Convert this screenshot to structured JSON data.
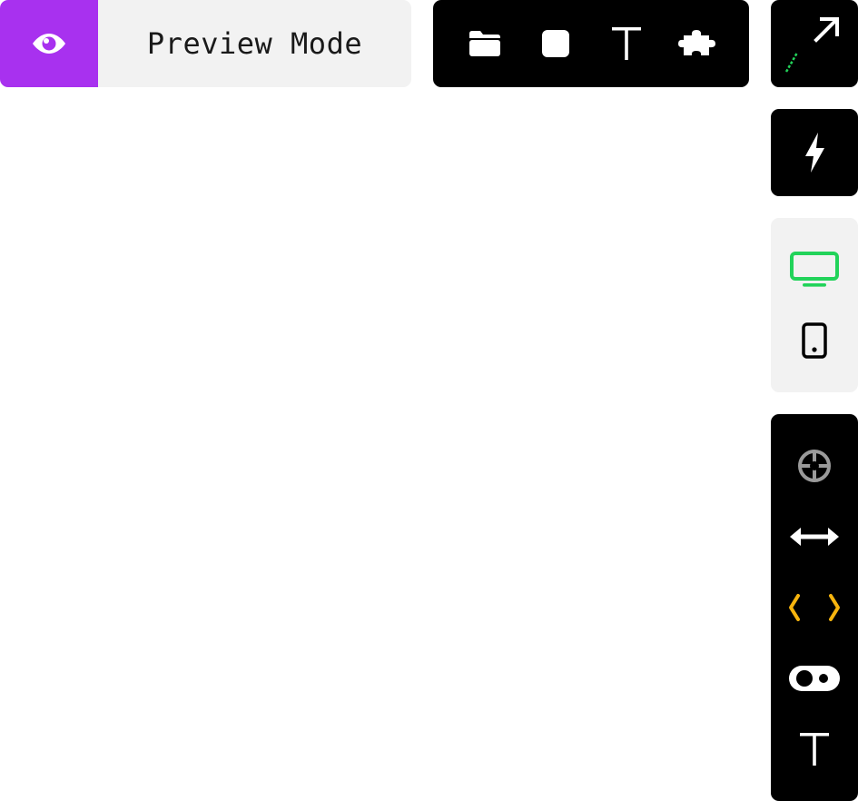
{
  "preview": {
    "icon": "eye-icon",
    "label": "Preview Mode",
    "accent": "#a831ef"
  },
  "toolbar": {
    "tools": [
      {
        "name": "folder-icon"
      },
      {
        "name": "square-icon"
      },
      {
        "name": "text-icon"
      },
      {
        "name": "puzzle-icon"
      }
    ]
  },
  "sidepanel": {
    "link_icon": "arrow-up-right-icon",
    "power_icon": "lightning-icon",
    "devices": [
      {
        "name": "desktop-icon",
        "active": true
      },
      {
        "name": "mobile-icon",
        "active": false
      }
    ],
    "tools": [
      {
        "name": "crosshair-icon"
      },
      {
        "name": "horizontal-resize-icon"
      },
      {
        "name": "code-brackets-icon"
      },
      {
        "name": "toggle-icon"
      },
      {
        "name": "text-icon"
      }
    ]
  },
  "colors": {
    "accent_purple": "#a831ef",
    "green": "#22d35a",
    "yellow": "#f6b40e",
    "gray_icon": "#9a9a9a"
  }
}
